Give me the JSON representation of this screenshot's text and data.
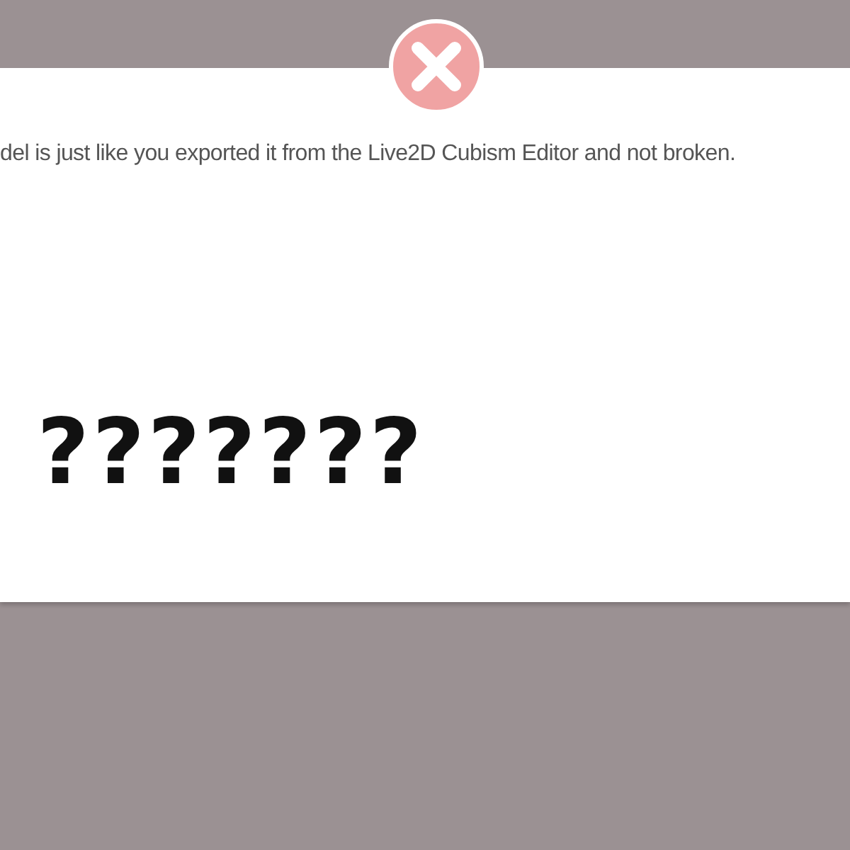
{
  "dialog": {
    "message": "del is just like you exported it from the Live2D Cubism Editor and not broken.",
    "garbled_text": "???????"
  }
}
